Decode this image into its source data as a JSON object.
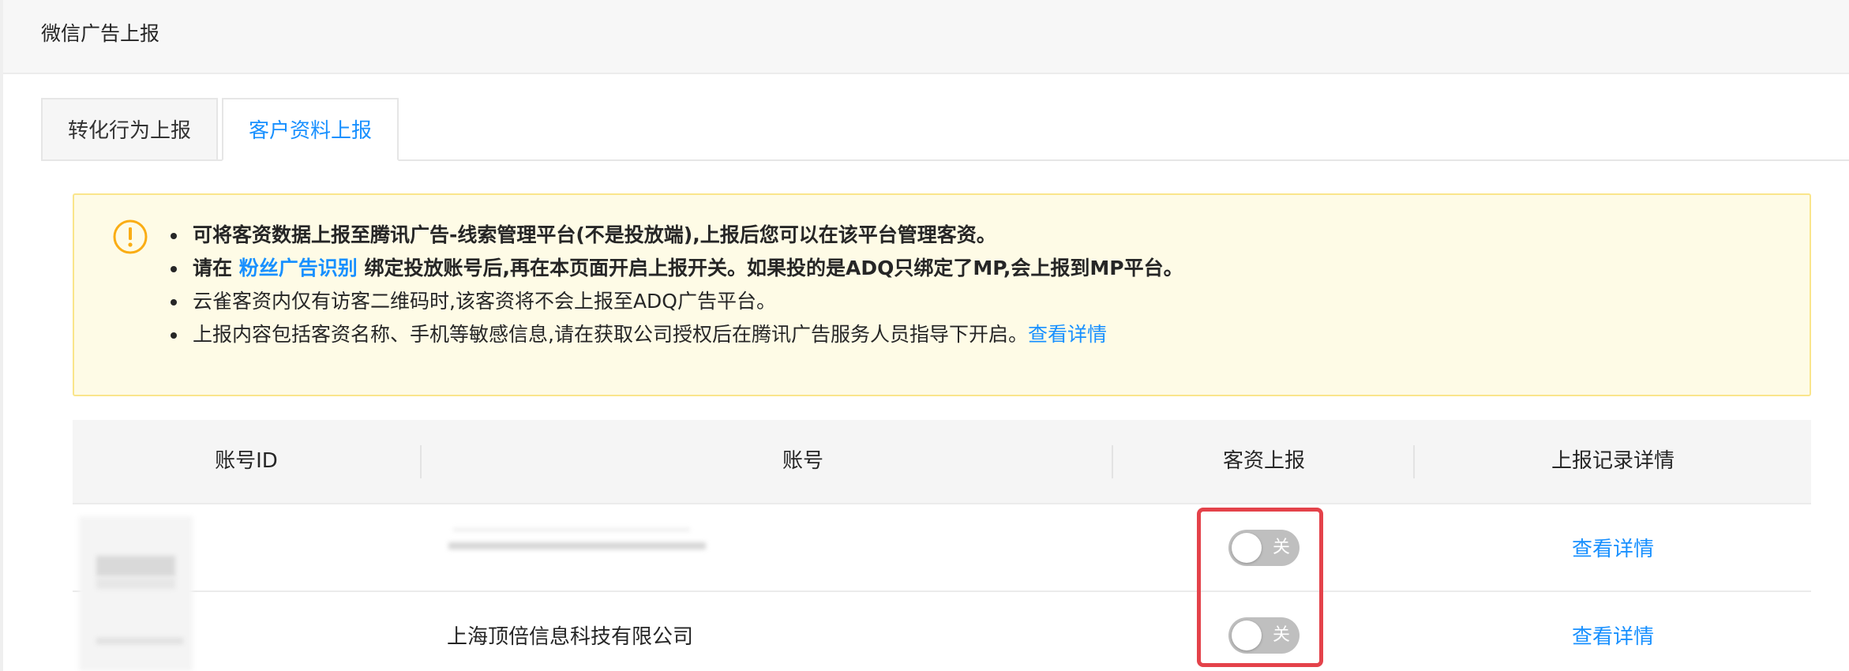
{
  "header": {
    "title": "微信广告上报"
  },
  "tabs": [
    {
      "label": "转化行为上报",
      "active": false
    },
    {
      "label": "客户资料上报",
      "active": true
    }
  ],
  "notice": {
    "icon": "warning-circle-icon",
    "items": [
      {
        "text": "可将客资数据上报至腾讯广告-线索管理平台(不是投放端),上报后您可以在该平台管理客资。"
      },
      {
        "prefix": "请在",
        "link": "粉丝广告识别",
        "suffix": "绑定投放账号后,再在本页面开启上报开关。如果投的是ADQ只绑定了MP,会上报到MP平台。"
      },
      {
        "text": "云雀客资内仅有访客二维码时,该客资将不会上报至ADQ广告平台。"
      },
      {
        "text": "上报内容包括客资名称、手机等敏感信息,请在获取公司授权后在腾讯广告服务人员指导下开启。",
        "link": "查看详情"
      }
    ]
  },
  "table": {
    "columns": [
      "账号ID",
      "账号",
      "客资上报",
      "上报记录详情"
    ],
    "rows": [
      {
        "account_id": "",
        "account": "",
        "report_toggle": "关",
        "report_on": false,
        "detail_link": "查看详情"
      },
      {
        "account_id": "",
        "account": "上海顶倍信息科技有限公司",
        "report_toggle": "关",
        "report_on": false,
        "detail_link": "查看详情"
      }
    ]
  },
  "colors": {
    "accent": "#1890ff",
    "notice_bg": "#fefbe6",
    "notice_border": "#fae58b",
    "warning_icon": "#faad14",
    "toggle_off": "#bfbfbf",
    "highlight": "#e4424a"
  }
}
